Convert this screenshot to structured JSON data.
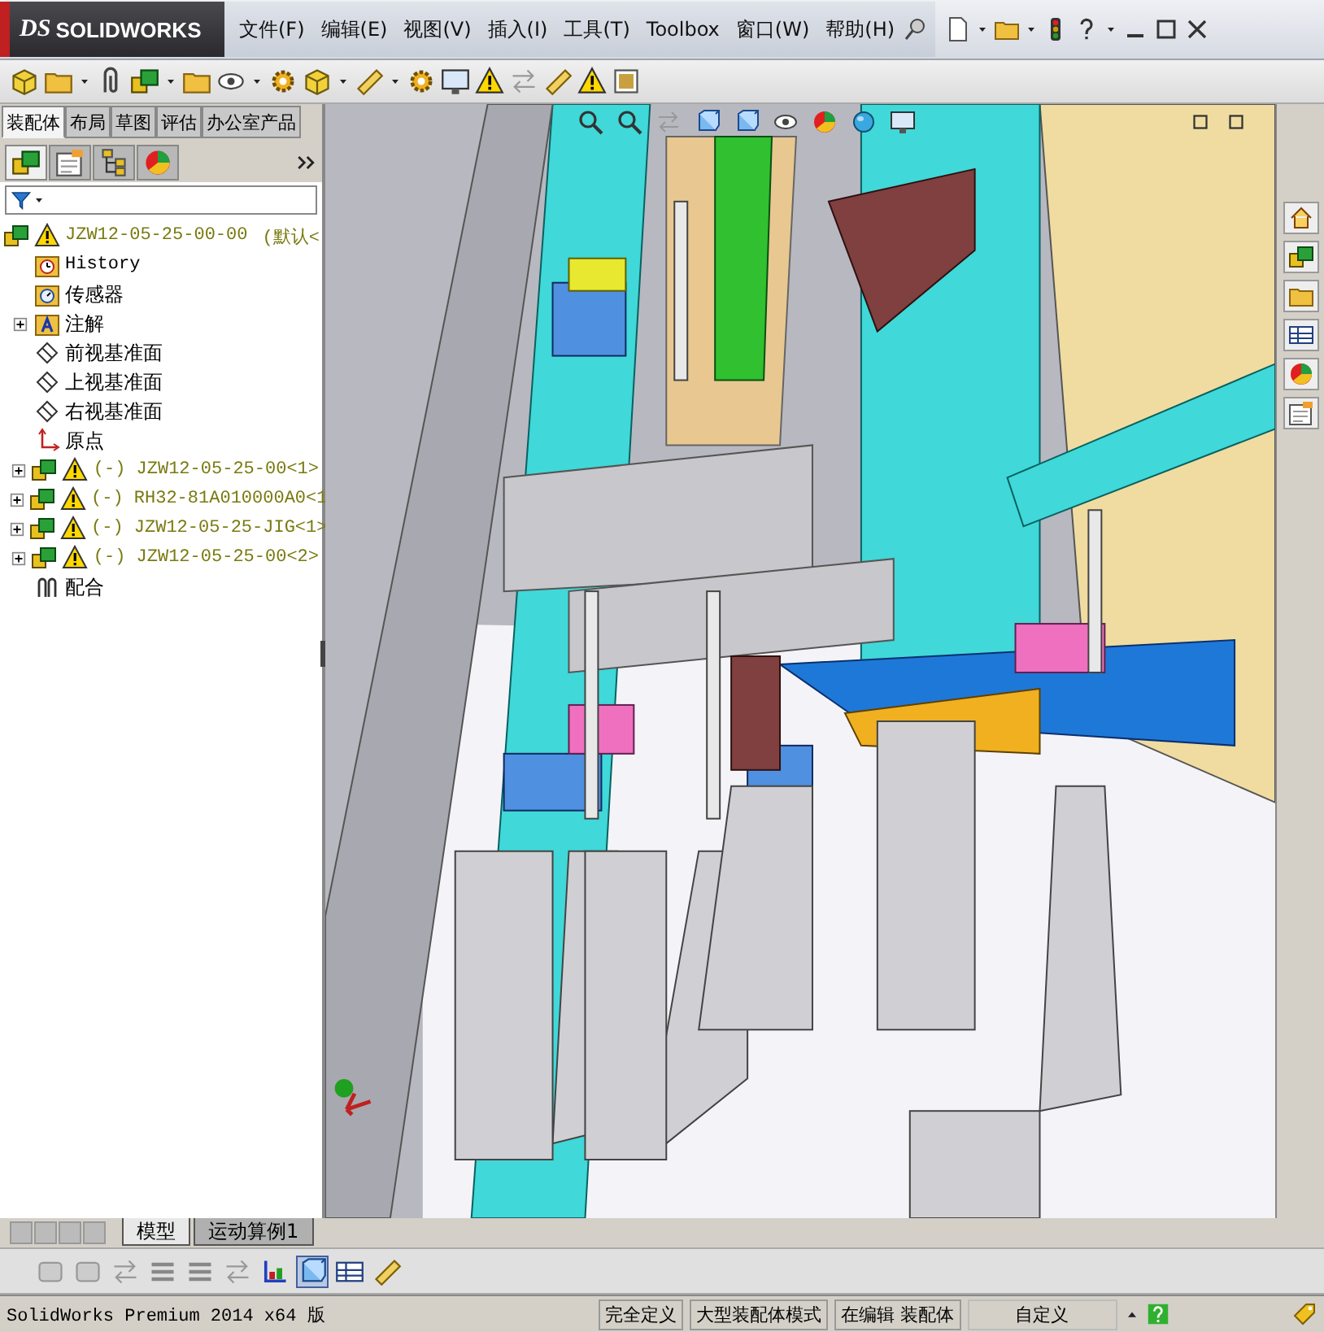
{
  "app": {
    "logo_mark": "DS",
    "logo": "SOLIDWORKS"
  },
  "menu": [
    "文件(F)",
    "编辑(E)",
    "视图(V)",
    "插入(I)",
    "工具(T)",
    "Toolbox",
    "窗口(W)",
    "帮助(H)"
  ],
  "command_tabs": [
    {
      "label": "装配体",
      "selected": true
    },
    {
      "label": "布局",
      "selected": false
    },
    {
      "label": "草图",
      "selected": false
    },
    {
      "label": "评估",
      "selected": false
    },
    {
      "label": "办公室产品",
      "selected": false
    }
  ],
  "panel_tabs": [
    {
      "kind": "tree",
      "selected": true
    },
    {
      "kind": "property",
      "selected": false
    },
    {
      "kind": "config",
      "selected": false
    },
    {
      "kind": "appearance",
      "selected": false
    }
  ],
  "tree": {
    "label": "JZW12-05-25-00-00",
    "suffix": "(默认<",
    "warning": true,
    "children": [
      {
        "kind": "history",
        "label": "History"
      },
      {
        "kind": "sensors",
        "label": "传感器"
      },
      {
        "kind": "annotations",
        "label": "注解",
        "expanded": false
      },
      {
        "kind": "plane",
        "label": "前视基准面"
      },
      {
        "kind": "plane",
        "label": "上视基准面"
      },
      {
        "kind": "plane",
        "label": "右视基准面"
      },
      {
        "kind": "origin",
        "label": "原点"
      },
      {
        "kind": "component",
        "label": "(-) JZW12-05-25-00<1>",
        "warning": true,
        "expanded": false
      },
      {
        "kind": "component",
        "label": "(-) RH32-81A010000A0<1",
        "warning": true,
        "expanded": false
      },
      {
        "kind": "component",
        "label": "(-) JZW12-05-25-JIG<1>",
        "warning": true,
        "expanded": false
      },
      {
        "kind": "component",
        "label": "(-) JZW12-05-25-00<2>",
        "warning": true,
        "expanded": false
      },
      {
        "kind": "mates",
        "label": "配合"
      }
    ]
  },
  "model_tabs": [
    {
      "label": "模型",
      "selected": true
    },
    {
      "label": "运动算例1",
      "selected": false
    }
  ],
  "status_bar": {
    "product": "SolidWorks Premium 2014 x64 版",
    "fields": [
      "完全定义",
      "大型装配体模式",
      "在编辑 装配体"
    ],
    "units": "自定义"
  }
}
